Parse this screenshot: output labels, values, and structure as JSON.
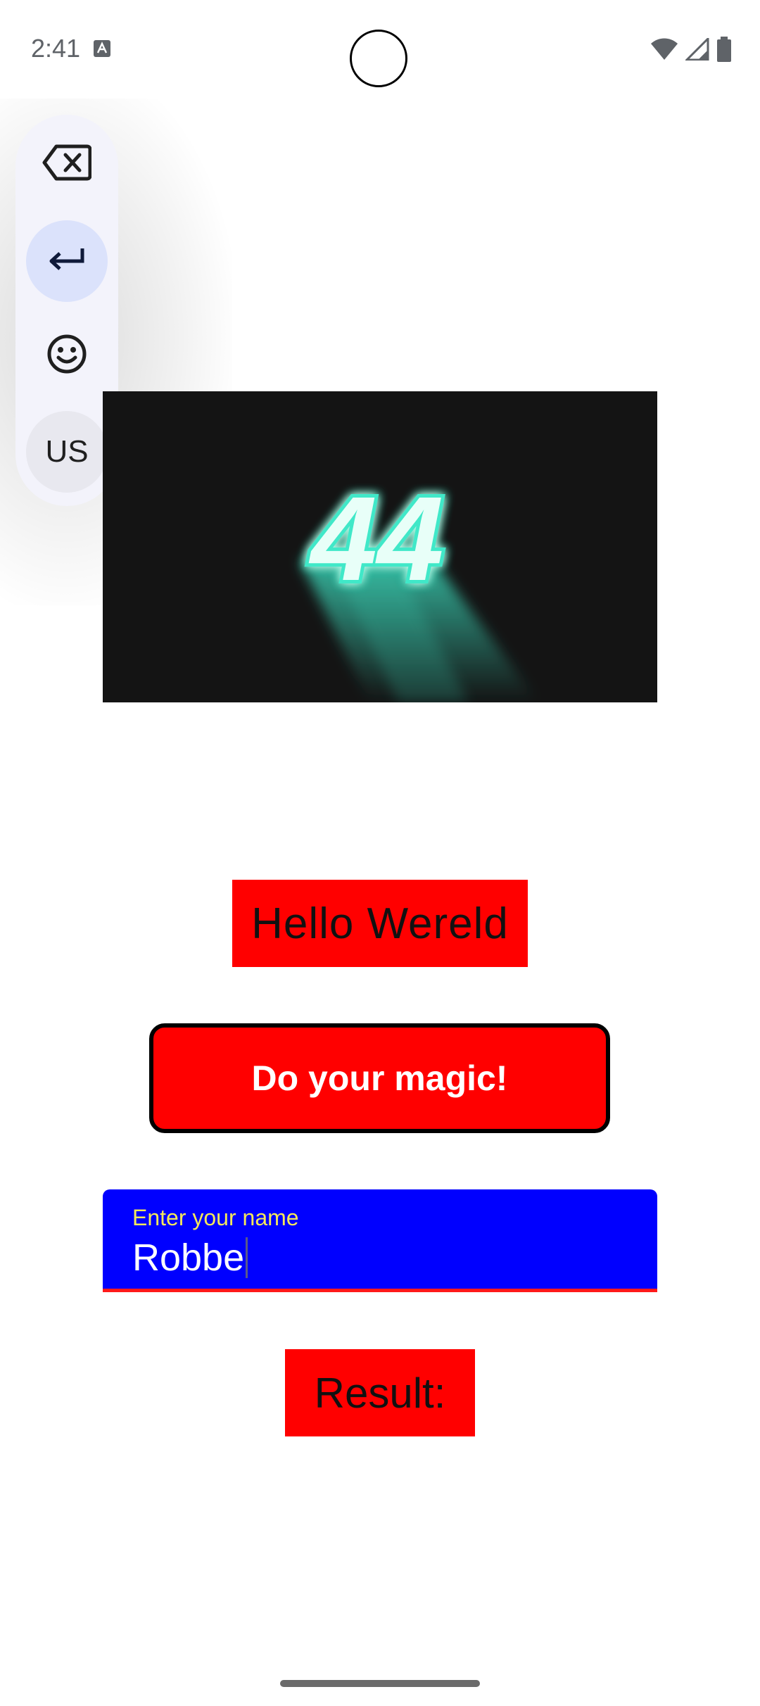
{
  "status_bar": {
    "time": "2:41",
    "icons": [
      "text-notification-icon",
      "wifi-icon",
      "cellular-signal-icon",
      "battery-icon"
    ]
  },
  "floating_toolbar": {
    "buttons": [
      {
        "icon": "backspace-icon"
      },
      {
        "icon": "enter-icon",
        "active": true
      },
      {
        "icon": "emoji-icon"
      },
      {
        "label": "US"
      }
    ]
  },
  "hero_image": {
    "text": "44",
    "glow_color": "#3fe8c8"
  },
  "hello_label": "Hello Wereld",
  "magic_button": "Do your magic!",
  "name_field": {
    "label": "Enter your name",
    "value": "Robbe"
  },
  "result_label": "Result:",
  "colors": {
    "label_background": "#ff0000",
    "field_background": "#0000ff",
    "field_label": "#f4e85a",
    "toolbar_background": "#f3f3fb",
    "toolbar_active": "#dbe2fb"
  }
}
